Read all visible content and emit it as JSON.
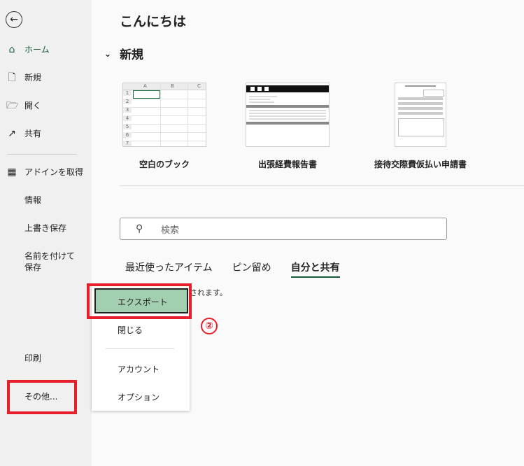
{
  "sidebar": {
    "back_icon": "back-arrow-icon",
    "items": [
      {
        "label": "ホーム",
        "icon": "home-icon",
        "active": true
      },
      {
        "label": "新規",
        "icon": "new-document-icon"
      },
      {
        "label": "開く",
        "icon": "folder-open-icon"
      },
      {
        "label": "共有",
        "icon": "share-icon"
      },
      {
        "label": "アドインを取得",
        "icon": "grid-icon"
      },
      {
        "label": "情報"
      },
      {
        "label": "上書き保存"
      },
      {
        "label": "名前を付けて保存"
      },
      {
        "label": "印刷"
      },
      {
        "label": "その他..."
      }
    ]
  },
  "main": {
    "greeting": "こんにちは",
    "new_section": {
      "title": "新規",
      "templates": [
        {
          "label": "空白のブック"
        },
        {
          "label": "出張経費報告書"
        },
        {
          "label": "接待交際費仮払い申請書"
        }
      ],
      "blank_columns": [
        "A",
        "B",
        "C"
      ],
      "blank_rows": [
        "1",
        "2",
        "3",
        "4",
        "5",
        "6",
        "7"
      ]
    },
    "search": {
      "placeholder": "検索"
    },
    "tabs": [
      {
        "label": "最近使ったアイテム"
      },
      {
        "label": "ピン留め"
      },
      {
        "label": "自分と共有",
        "active": true
      }
    ],
    "empty_message": "ドキュメントがここに表示されます。"
  },
  "popup": {
    "items": [
      "エクスポート",
      "閉じる",
      "アカウント",
      "オプション"
    ],
    "highlighted": "エクスポート"
  },
  "annotation": {
    "step_marker": "②",
    "color": "#e5202a"
  },
  "colors": {
    "accent": "#185c37",
    "highlight": "#a2cfb0"
  }
}
